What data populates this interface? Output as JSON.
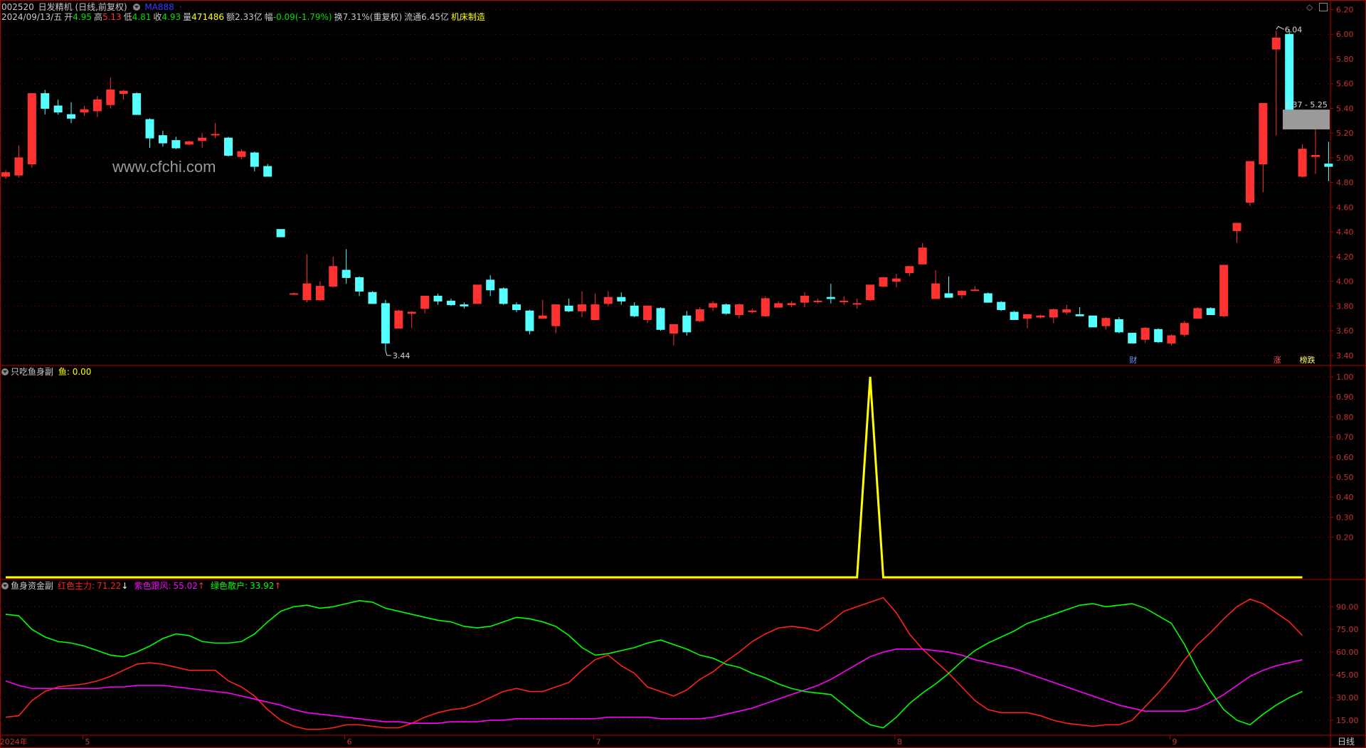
{
  "header": {
    "code": "002520",
    "name": "日发精机",
    "mode": "(日线,前复权)",
    "ma_label": "MA888",
    "date": "2024/09/13/五",
    "open_label": "开",
    "open": "4.95",
    "high_label": "高",
    "high": "5.13",
    "low_label": "低",
    "low": "4.81",
    "close_label": "收",
    "close": "4.93",
    "vol_label": "量",
    "vol": "471486",
    "amt_label": "额",
    "amt": "2.33亿",
    "chg_label": "幅",
    "chg": "-0.09(-1.79%)",
    "turn_label": "换",
    "turn": "7.31%(重复权)",
    "float_label": "流通",
    "float": "6.45亿",
    "industry": "机床制造"
  },
  "watermark": "www.cfchi.com",
  "sub1_header": {
    "name": "只吃鱼身副",
    "k": "鱼:",
    "v": "0.00"
  },
  "sub2_header": {
    "name": "鱼身资金副",
    "red_k": "红色主力:",
    "red_v": "71.22",
    "red_arrow": "↓",
    "pur_k": "紫色跟风:",
    "pur_v": "55.02",
    "pur_arrow": "↑",
    "grn_k": "绿色散户:",
    "grn_v": "33.92",
    "grn_arrow": "↑"
  },
  "bottom": {
    "period": "日线"
  },
  "colors": {
    "up": "#ff3232",
    "down": "#54ffff",
    "axis": "#b40000",
    "grid": "#5a0000",
    "fish": "#ffff00",
    "red_line": "#ff2020",
    "purple_line": "#ff00ff",
    "green_line": "#00ff00",
    "gray_zone": "#9a9a9a"
  },
  "chart_data": [
    {
      "type": "candlestick",
      "title": "",
      "ylim": [
        3.33,
        6.22
      ],
      "yticks": [
        "3.40",
        "3.60",
        "3.80",
        "4.00",
        "4.20",
        "4.40",
        "4.60",
        "4.80",
        "5.00",
        "5.20",
        "5.40",
        "5.60",
        "5.80",
        "6.00",
        "6.20"
      ],
      "candles": [
        [
          4.85,
          4.9,
          4.83,
          4.88
        ],
        [
          4.86,
          5.1,
          4.84,
          5.0
        ],
        [
          4.95,
          5.52,
          4.92,
          5.52
        ],
        [
          5.52,
          5.55,
          5.35,
          5.4
        ],
        [
          5.42,
          5.47,
          5.35,
          5.37
        ],
        [
          5.35,
          5.45,
          5.28,
          5.32
        ],
        [
          5.37,
          5.42,
          5.34,
          5.39
        ],
        [
          5.38,
          5.5,
          5.33,
          5.47
        ],
        [
          5.43,
          5.65,
          5.4,
          5.55
        ],
        [
          5.52,
          5.55,
          5.47,
          5.54
        ],
        [
          5.52,
          5.53,
          5.35,
          5.35
        ],
        [
          5.31,
          5.32,
          5.08,
          5.16
        ],
        [
          5.18,
          5.22,
          5.09,
          5.12
        ],
        [
          5.14,
          5.17,
          5.07,
          5.08
        ],
        [
          5.11,
          5.14,
          5.1,
          5.13
        ],
        [
          5.14,
          5.2,
          5.08,
          5.16
        ],
        [
          5.19,
          5.28,
          5.16,
          5.19
        ],
        [
          5.16,
          5.17,
          5.01,
          5.02
        ],
        [
          5.01,
          5.07,
          4.99,
          5.05
        ],
        [
          5.04,
          5.05,
          4.89,
          4.93
        ],
        [
          4.93,
          4.95,
          4.85,
          4.85
        ],
        [
          4.42,
          4.42,
          4.36,
          4.36
        ],
        [
          3.9,
          3.91,
          3.89,
          3.9
        ],
        [
          3.85,
          4.22,
          3.83,
          3.98
        ],
        [
          3.85,
          4.0,
          3.84,
          3.96
        ],
        [
          3.96,
          4.2,
          3.95,
          4.12
        ],
        [
          4.09,
          4.26,
          3.98,
          4.03
        ],
        [
          4.03,
          4.04,
          3.88,
          3.92
        ],
        [
          3.91,
          3.92,
          3.82,
          3.82
        ],
        [
          3.82,
          3.85,
          3.44,
          3.5
        ],
        [
          3.62,
          3.77,
          3.62,
          3.76
        ],
        [
          3.74,
          3.76,
          3.62,
          3.75
        ],
        [
          3.78,
          3.88,
          3.74,
          3.88
        ],
        [
          3.88,
          3.9,
          3.81,
          3.84
        ],
        [
          3.84,
          3.86,
          3.8,
          3.81
        ],
        [
          3.81,
          3.83,
          3.78,
          3.8
        ],
        [
          3.82,
          3.97,
          3.82,
          3.97
        ],
        [
          4.01,
          4.05,
          3.88,
          3.93
        ],
        [
          3.94,
          3.95,
          3.81,
          3.82
        ],
        [
          3.81,
          3.83,
          3.75,
          3.77
        ],
        [
          3.76,
          3.77,
          3.57,
          3.6
        ],
        [
          3.7,
          3.85,
          3.7,
          3.72
        ],
        [
          3.64,
          3.81,
          3.58,
          3.81
        ],
        [
          3.8,
          3.86,
          3.75,
          3.76
        ],
        [
          3.76,
          3.92,
          3.71,
          3.81
        ],
        [
          3.69,
          3.9,
          3.69,
          3.81
        ],
        [
          3.82,
          3.92,
          3.8,
          3.87
        ],
        [
          3.87,
          3.91,
          3.81,
          3.84
        ],
        [
          3.8,
          3.83,
          3.71,
          3.72
        ],
        [
          3.69,
          3.8,
          3.66,
          3.8
        ],
        [
          3.78,
          3.79,
          3.6,
          3.61
        ],
        [
          3.58,
          3.65,
          3.48,
          3.65
        ],
        [
          3.72,
          3.76,
          3.56,
          3.59
        ],
        [
          3.68,
          3.79,
          3.67,
          3.77
        ],
        [
          3.79,
          3.84,
          3.76,
          3.82
        ],
        [
          3.81,
          3.82,
          3.73,
          3.74
        ],
        [
          3.73,
          3.82,
          3.7,
          3.81
        ],
        [
          3.76,
          3.78,
          3.74,
          3.76
        ],
        [
          3.72,
          3.88,
          3.71,
          3.86
        ],
        [
          3.79,
          3.84,
          3.79,
          3.82
        ],
        [
          3.81,
          3.84,
          3.79,
          3.82
        ],
        [
          3.83,
          3.91,
          3.79,
          3.88
        ],
        [
          3.84,
          3.86,
          3.82,
          3.84
        ],
        [
          3.87,
          3.98,
          3.82,
          3.86
        ],
        [
          3.84,
          3.88,
          3.81,
          3.84
        ],
        [
          3.82,
          3.86,
          3.78,
          3.82
        ],
        [
          3.85,
          3.97,
          3.84,
          3.97
        ],
        [
          3.96,
          4.03,
          3.96,
          4.03
        ],
        [
          4.0,
          4.06,
          3.95,
          4.02
        ],
        [
          4.07,
          4.12,
          4.04,
          4.12
        ],
        [
          4.14,
          4.31,
          4.14,
          4.27
        ],
        [
          3.86,
          4.09,
          3.86,
          3.98
        ],
        [
          3.9,
          4.04,
          3.87,
          3.87
        ],
        [
          3.89,
          3.93,
          3.86,
          3.92
        ],
        [
          3.93,
          3.96,
          3.92,
          3.93
        ],
        [
          3.9,
          3.91,
          3.84,
          3.83
        ],
        [
          3.83,
          3.84,
          3.76,
          3.77
        ],
        [
          3.75,
          3.76,
          3.69,
          3.69
        ],
        [
          3.7,
          3.73,
          3.62,
          3.73
        ],
        [
          3.71,
          3.73,
          3.7,
          3.72
        ],
        [
          3.71,
          3.78,
          3.66,
          3.77
        ],
        [
          3.75,
          3.81,
          3.73,
          3.77
        ],
        [
          3.73,
          3.79,
          3.72,
          3.72
        ],
        [
          3.72,
          3.72,
          3.63,
          3.63
        ],
        [
          3.64,
          3.71,
          3.61,
          3.7
        ],
        [
          3.69,
          3.71,
          3.58,
          3.59
        ],
        [
          3.58,
          3.58,
          3.5,
          3.5
        ],
        [
          3.53,
          3.63,
          3.5,
          3.62
        ],
        [
          3.61,
          3.62,
          3.5,
          3.51
        ],
        [
          3.5,
          3.57,
          3.48,
          3.56
        ],
        [
          3.57,
          3.68,
          3.55,
          3.66
        ],
        [
          3.7,
          3.79,
          3.7,
          3.78
        ],
        [
          3.78,
          3.79,
          3.73,
          3.73
        ],
        [
          3.72,
          4.13,
          3.71,
          4.13
        ],
        [
          4.41,
          4.47,
          4.31,
          4.47
        ],
        [
          4.64,
          4.97,
          4.61,
          4.97
        ],
        [
          4.95,
          5.44,
          4.72,
          5.44
        ],
        [
          5.88,
          6.03,
          5.18,
          5.97
        ],
        [
          6.0,
          6.04,
          5.37,
          5.37
        ],
        [
          4.85,
          5.11,
          4.84,
          5.07
        ],
        [
          5.01,
          5.27,
          4.87,
          5.02
        ],
        [
          4.95,
          5.13,
          4.81,
          4.93
        ]
      ],
      "annotations": {
        "low": "3.44",
        "high": "6.04",
        "zone": "5.37 - 5.25",
        "zone_low": 5.25,
        "zone_high": 5.37
      },
      "event_tags": [
        {
          "label": "财",
          "index": 86
        },
        {
          "label": "涨",
          "index": 97
        },
        {
          "label": "榜跌",
          "index": 99
        }
      ]
    },
    {
      "type": "line",
      "title": "",
      "ylim": [
        0,
        1
      ],
      "yticks": [
        "0.20",
        "0.30",
        "0.40",
        "0.50",
        "0.60",
        "0.70",
        "0.80",
        "0.90",
        "1.00"
      ],
      "series": [
        {
          "name": "鱼",
          "values": [
            0,
            0,
            0,
            0,
            0,
            0,
            0,
            0,
            0,
            0,
            0,
            0,
            0,
            0,
            0,
            0,
            0,
            0,
            0,
            0,
            0,
            0,
            0,
            0,
            0,
            0,
            0,
            0,
            0,
            0,
            0,
            0,
            0,
            0,
            0,
            0,
            0,
            0,
            0,
            0,
            0,
            0,
            0,
            0,
            0,
            0,
            0,
            0,
            0,
            0,
            0,
            0,
            0,
            0,
            0,
            0,
            0,
            0,
            0,
            0,
            0,
            0,
            0,
            0,
            0,
            0,
            1,
            0,
            0,
            0,
            0,
            0,
            0,
            0,
            0,
            0,
            0,
            0,
            0,
            0,
            0,
            0,
            0,
            0,
            0,
            0,
            0,
            0,
            0,
            0,
            0,
            0,
            0,
            0,
            0,
            0,
            0,
            0,
            0,
            0
          ]
        }
      ]
    },
    {
      "type": "line",
      "title": "",
      "ylim": [
        7,
        100
      ],
      "yticks": [
        "15.00",
        "30.00",
        "45.00",
        "60.00",
        "75.00",
        "90.00"
      ],
      "series": [
        {
          "name": "红色主力",
          "values": [
            17,
            18,
            28,
            34,
            37,
            38,
            39,
            41,
            44,
            48,
            52,
            53,
            52,
            50,
            48,
            48,
            48,
            41,
            37,
            31,
            22,
            15,
            11,
            9,
            9,
            10,
            12,
            12,
            11,
            10,
            10,
            13,
            17,
            20,
            22,
            23,
            26,
            30,
            34,
            36,
            34,
            34,
            37,
            40,
            48,
            55,
            58,
            51,
            46,
            37,
            34,
            31,
            35,
            42,
            47,
            54,
            60,
            67,
            72,
            76,
            77,
            76,
            74,
            80,
            87,
            90,
            93,
            96,
            86,
            72,
            62,
            54,
            46,
            37,
            28,
            22,
            20,
            20,
            20,
            18,
            15,
            13,
            12,
            11,
            12,
            12,
            15,
            24,
            33,
            43,
            55,
            65,
            73,
            82,
            90,
            95,
            92,
            86,
            80,
            71
          ]
        },
        {
          "name": "紫色跟风",
          "values": [
            41,
            38,
            36,
            36,
            36,
            36,
            36,
            36,
            37,
            37,
            38,
            38,
            38,
            37,
            36,
            35,
            34,
            33,
            31,
            29,
            27,
            25,
            22,
            20,
            19,
            18,
            17,
            16,
            15,
            14,
            14,
            13,
            13,
            13,
            14,
            14,
            14,
            15,
            15,
            16,
            16,
            16,
            16,
            16,
            16,
            16,
            17,
            17,
            17,
            17,
            16,
            16,
            16,
            16,
            17,
            19,
            21,
            23,
            26,
            29,
            32,
            35,
            38,
            42,
            47,
            52,
            57,
            60,
            62,
            62,
            62,
            61,
            60,
            58,
            55,
            53,
            51,
            49,
            46,
            43,
            40,
            37,
            34,
            31,
            28,
            25,
            23,
            21,
            21,
            21,
            21,
            23,
            27,
            32,
            38,
            44,
            48,
            51,
            53,
            55
          ]
        },
        {
          "name": "绿色散户",
          "values": [
            85,
            84,
            75,
            70,
            67,
            66,
            64,
            61,
            58,
            57,
            60,
            64,
            69,
            72,
            71,
            67,
            66,
            66,
            67,
            72,
            80,
            87,
            90,
            91,
            89,
            90,
            92,
            94,
            93,
            89,
            87,
            85,
            83,
            81,
            80,
            77,
            76,
            77,
            80,
            83,
            82,
            80,
            77,
            71,
            63,
            58,
            59,
            61,
            63,
            66,
            68,
            65,
            62,
            58,
            56,
            52,
            50,
            46,
            43,
            39,
            36,
            34,
            33,
            32,
            25,
            18,
            12,
            10,
            17,
            26,
            33,
            39,
            46,
            54,
            61,
            66,
            70,
            74,
            79,
            82,
            85,
            88,
            91,
            92,
            90,
            91,
            92,
            89,
            84,
            79,
            65,
            48,
            34,
            22,
            15,
            12,
            19,
            25,
            30,
            34
          ]
        }
      ]
    }
  ],
  "x_axis": {
    "labels": [
      {
        "text": "2024年",
        "index": -0.5
      },
      {
        "text": "5",
        "index": 6
      },
      {
        "text": "6",
        "index": 26
      },
      {
        "text": "7",
        "index": 45
      },
      {
        "text": "8",
        "index": 68
      },
      {
        "text": "9",
        "index": 89
      }
    ]
  }
}
